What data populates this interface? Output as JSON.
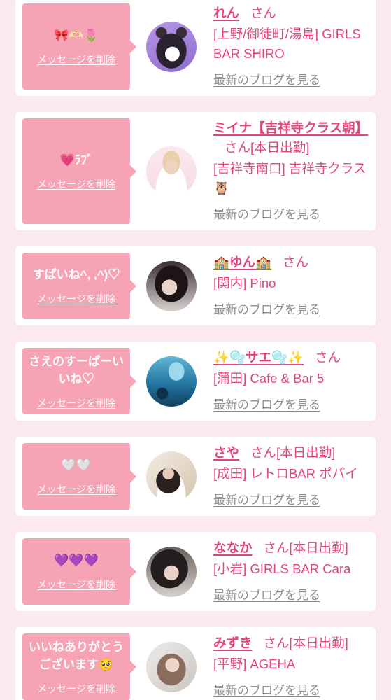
{
  "theme": {
    "background": "#fce9ef",
    "accent": "#e4457f",
    "bubble": "#f6a3b6",
    "link_gray": "#8c8c8c"
  },
  "labels": {
    "delete_message": "メッセージを削除",
    "latest_blog": "最新のブログを見る",
    "honorific": "さん"
  },
  "messages": [
    {
      "message": "🎀🫶🏻🌷",
      "name": "れん",
      "area": "[上野/御徒町/湯島]",
      "store": "GIRLS BAR SHIRO"
    },
    {
      "message": "💗ﾗﾌﾞ",
      "name": "ミイナ【吉祥寺クラス朝】",
      "status": "[本日出勤]",
      "area": "[吉祥寺南口]",
      "store": "吉祥寺クラス🦉"
    },
    {
      "message": "すぱいね^, ,^)♡",
      "name": "🏫ゆん🏫",
      "area": "[関内]",
      "store": "Pino"
    },
    {
      "message": "さえのすーぱーいいね♡",
      "name": "✨🫧サエ🫧✨",
      "area": "[蒲田]",
      "store": "Cafe & Bar 5"
    },
    {
      "message": "🤍🤍",
      "name": "さや",
      "status": "[本日出勤]",
      "area": "[成田]",
      "store": "レトロBAR ポパイ"
    },
    {
      "message": "💜💜💜",
      "name": "ななか",
      "status": "[本日出勤]",
      "area": "[小岩]",
      "store": "GIRLS BAR Cara"
    },
    {
      "message": "いいねありがとうございます🥺",
      "name": "みずき",
      "status": "[本日出勤]",
      "area": "[平野]",
      "store": "AGEHA"
    }
  ]
}
